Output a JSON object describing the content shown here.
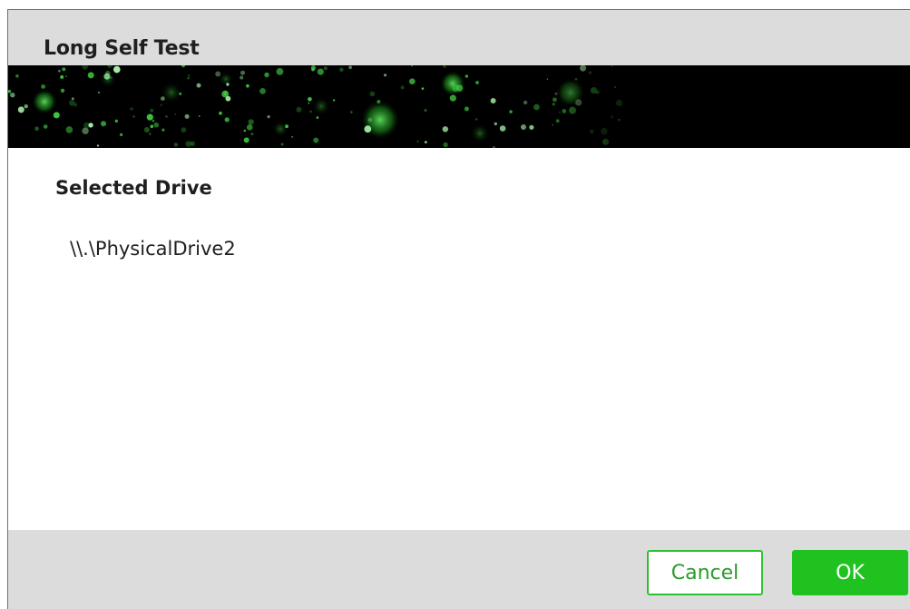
{
  "dialog": {
    "title": "Long Self Test"
  },
  "selected_drive": {
    "label": "Selected Drive",
    "value": "\\\\.\\PhysicalDrive2"
  },
  "footer": {
    "cancel_label": "Cancel",
    "ok_label": "OK"
  },
  "colors": {
    "title_bar": "#dcdcdc",
    "banner_background": "#000000",
    "banner_particles": "#3ec83e",
    "accent_green": "#1fc21f",
    "cancel_border": "#2ec12e"
  }
}
